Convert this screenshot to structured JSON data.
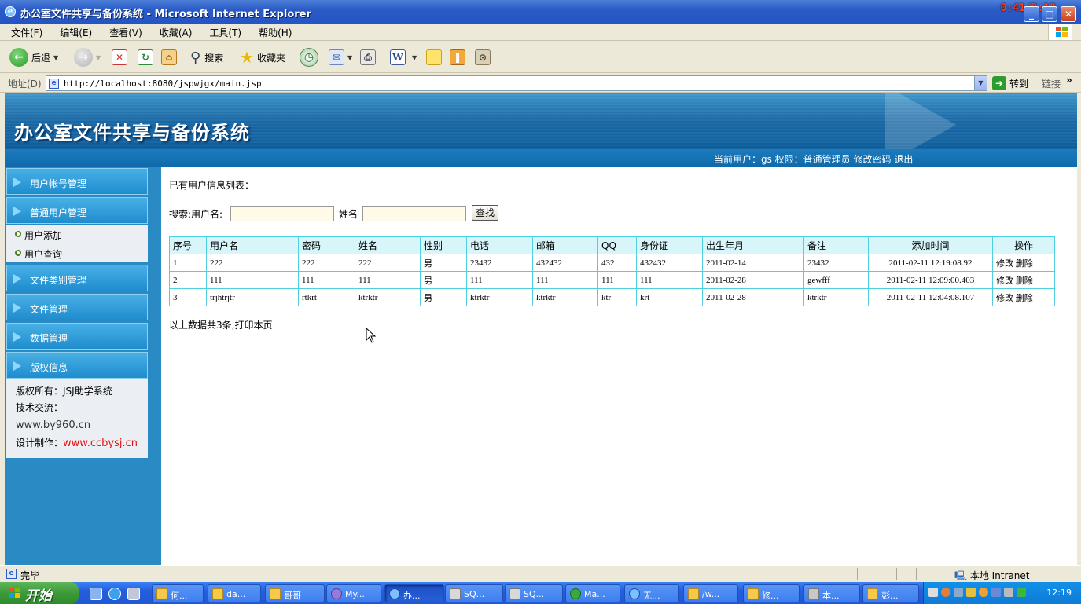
{
  "window": {
    "title": "办公室文件共享与备份系统 - Microsoft Internet Explorer",
    "timer": "0:41/2:18"
  },
  "menu": [
    "文件(F)",
    "编辑(E)",
    "查看(V)",
    "收藏(A)",
    "工具(T)",
    "帮助(H)"
  ],
  "toolbar": {
    "back": "后退",
    "search": "搜索",
    "favorites": "收藏夹"
  },
  "address": {
    "label": "地址(D)",
    "url": "http://localhost:8080/jspwjgx/main.jsp",
    "go": "转到",
    "links": "链接"
  },
  "banner": {
    "system_title": "办公室文件共享与备份系统",
    "user_info": "当前用户：gs  权限：普通管理员 修改密码   退出"
  },
  "sidebar": {
    "menu1": "用户帐号管理",
    "menu2": "普通用户管理",
    "sub1": "用户添加",
    "sub2": "用户查询",
    "menu3": "文件类别管理",
    "menu4": "文件管理",
    "menu5": "数据管理",
    "menu6": "版权信息",
    "copyright_owner": "版权所有：JSJ助学系统",
    "tech": "技术交流：",
    "site": "www.by960.cn",
    "design_label": "设计制作：",
    "design_url": "www.ccbysj.cn"
  },
  "content": {
    "heading": "已有用户信息列表：",
    "search_label": "搜索:用户名:",
    "name_label": "姓名",
    "search_button": "查找",
    "username_value": "",
    "name_value": "",
    "footer": "以上数据共3条,打印本页"
  },
  "table": {
    "headers": [
      "序号",
      "用户名",
      "密码",
      "姓名",
      "性别",
      "电话",
      "邮箱",
      "QQ",
      "身份证",
      "出生年月",
      "备注",
      "添加时间",
      "操作"
    ],
    "rows": [
      {
        "no": "1",
        "user": "222",
        "pwd": "222",
        "name": "222",
        "sex": "男",
        "phone": "23432",
        "mail": "432432",
        "qq": "432",
        "idcard": "432432",
        "birth": "2011-02-14",
        "note": "23432",
        "added": "2011-02-11 12:19:08.92",
        "edit": "修改",
        "del": "删除"
      },
      {
        "no": "2",
        "user": "111",
        "pwd": "111",
        "name": "111",
        "sex": "男",
        "phone": "111",
        "mail": "111",
        "qq": "111",
        "idcard": "111",
        "birth": "2011-02-28",
        "note": "gewfff",
        "added": "2011-02-11 12:09:00.403",
        "edit": "修改",
        "del": "删除"
      },
      {
        "no": "3",
        "user": "trjhtrjtr",
        "pwd": "rtkrt",
        "name": "ktrktr",
        "sex": "男",
        "phone": "ktrktr",
        "mail": "ktrktr",
        "qq": "ktr",
        "idcard": "krt",
        "birth": "2011-02-28",
        "note": "ktrktr",
        "added": "2011-02-11 12:04:08.107",
        "edit": "修改",
        "del": "删除"
      }
    ]
  },
  "status": {
    "text": "完毕",
    "zone": "本地 Intranet"
  },
  "taskbar": {
    "start": "开始",
    "tasks": [
      "何...",
      "da...",
      "哥哥",
      "My...",
      "办...",
      "SQ...",
      "SQ...",
      "Ma...",
      "无...",
      "/w...",
      "修...",
      "本...",
      "彭..."
    ],
    "clock": "12:19"
  },
  "colors": {
    "banner": "#1c6aa6",
    "sidebar": "#2a8ac4",
    "table_border": "#4dd0e1",
    "header_bg": "#d8f6fa",
    "design_url": "#e01010"
  }
}
